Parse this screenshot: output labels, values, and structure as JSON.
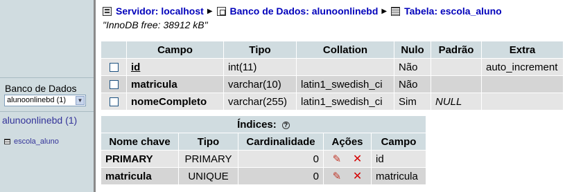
{
  "nav": {
    "db_label": "Banco de Dados",
    "db_select_value": "alunoonlinebd (1)",
    "db_link": "alunoonlinebd (1)",
    "table_item": "escola_aluno"
  },
  "breadcrumb": {
    "server": "Servidor: localhost",
    "database": "Banco de Dados: alunoonlinebd",
    "table": "Tabela: escola_aluno"
  },
  "engine_note": "\"InnoDB free: 38912 kB\"",
  "fields": {
    "headers": [
      "Campo",
      "Tipo",
      "Collation",
      "Nulo",
      "Padrão",
      "Extra"
    ],
    "rows": [
      {
        "campo": "id",
        "tipo": "int(11)",
        "collation": "",
        "nulo": "Não",
        "padrao": "",
        "extra": "auto_increment"
      },
      {
        "campo": "matricula",
        "tipo": "varchar(10)",
        "collation": "latin1_swedish_ci",
        "nulo": "Não",
        "padrao": "",
        "extra": ""
      },
      {
        "campo": "nomeCompleto",
        "tipo": "varchar(255)",
        "collation": "latin1_swedish_ci",
        "nulo": "Sim",
        "padrao": "NULL",
        "extra": ""
      }
    ]
  },
  "indexes": {
    "title": "Índices:",
    "headers": [
      "Nome chave",
      "Tipo",
      "Cardinalidade",
      "Ações",
      "Campo"
    ],
    "rows": [
      {
        "nome": "PRIMARY",
        "tipo": "PRIMARY",
        "cardinalidade": "0",
        "campo": "id"
      },
      {
        "nome": "matricula",
        "tipo": "UNIQUE",
        "cardinalidade": "0",
        "campo": "matricula"
      }
    ]
  }
}
